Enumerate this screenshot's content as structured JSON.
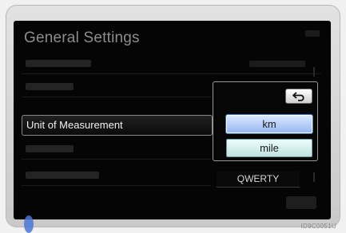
{
  "screen": {
    "title": "General Settings",
    "rows": [
      {
        "name": "row-1"
      },
      {
        "name": "row-2"
      },
      {
        "label": "Unit of Measurement"
      },
      {
        "name": "row-4"
      },
      {
        "name": "row-5"
      }
    ]
  },
  "popup": {
    "options": [
      {
        "label": "km",
        "selected": true
      },
      {
        "label": "mile",
        "selected": false
      }
    ]
  },
  "keyboard_layout": {
    "value": "QWERTY"
  },
  "image_code": "ID9C0051U",
  "colors": {
    "accent": "#3a6fc4",
    "screen_bg": "#050505"
  }
}
